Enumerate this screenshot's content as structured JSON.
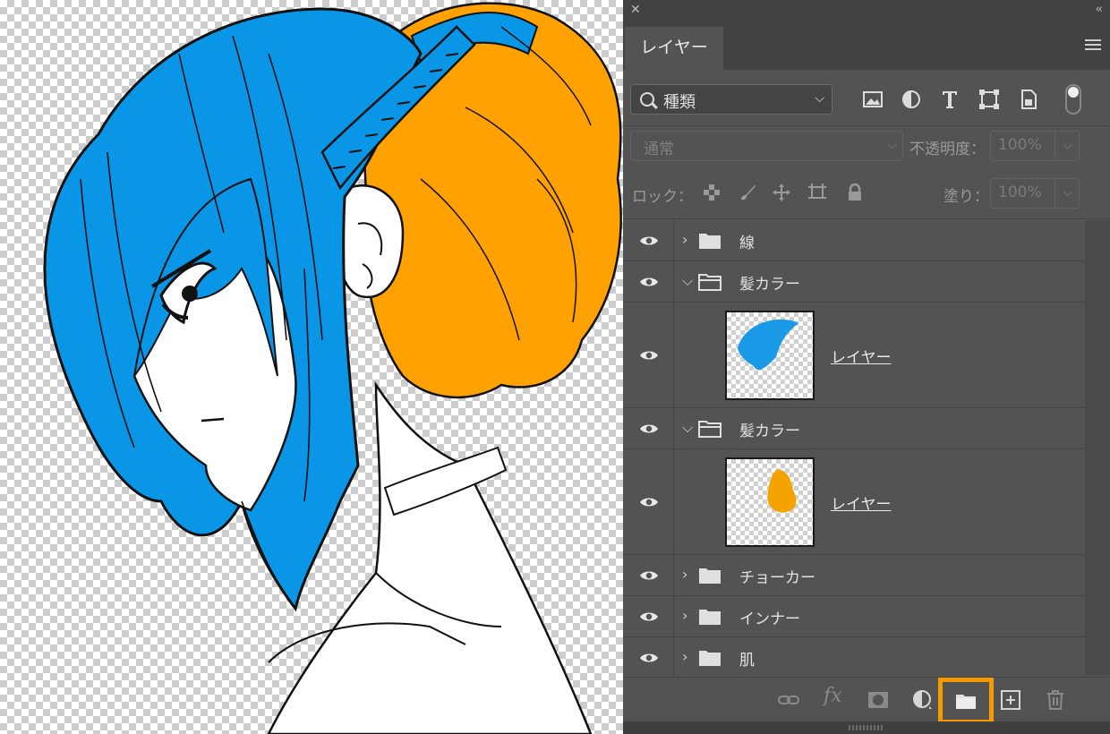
{
  "panel": {
    "tab_label": "レイヤー",
    "filter": {
      "selected": "種類",
      "icons": [
        "image-filter-icon",
        "adjustment-filter-icon",
        "type-filter-icon",
        "shape-filter-icon",
        "smart-object-filter-icon"
      ]
    },
    "blend_mode": "通常",
    "opacity_label": "不透明度：",
    "opacity_value": "100%",
    "lock_label": "ロック：",
    "fill_label": "塗り：",
    "fill_value": "100%"
  },
  "layers": [
    {
      "kind": "group",
      "name": "線",
      "expanded": false
    },
    {
      "kind": "group",
      "name": "髪カラー",
      "expanded": true
    },
    {
      "kind": "layer",
      "name": "レイヤー",
      "thumb_color": "#1a9ae6"
    },
    {
      "kind": "group",
      "name": "髪カラー",
      "expanded": true
    },
    {
      "kind": "layer",
      "name": "レイヤー",
      "thumb_color": "#f5a300"
    },
    {
      "kind": "group",
      "name": "チョーカー",
      "expanded": false
    },
    {
      "kind": "group",
      "name": "インナー",
      "expanded": false
    },
    {
      "kind": "group",
      "name": "肌",
      "expanded": false
    }
  ],
  "bottom_toolbar": {
    "fx_label": "fx",
    "icons": [
      "link-icon",
      "fx-icon",
      "mask-icon",
      "adjustment-icon",
      "new-group-icon",
      "new-layer-icon",
      "trash-icon"
    ],
    "highlighted": "new-group-icon"
  },
  "colors": {
    "hair_blue": "#0a96e6",
    "hair_orange": "#ffa100",
    "panel_bg": "#535353",
    "highlight": "#f59b00"
  }
}
